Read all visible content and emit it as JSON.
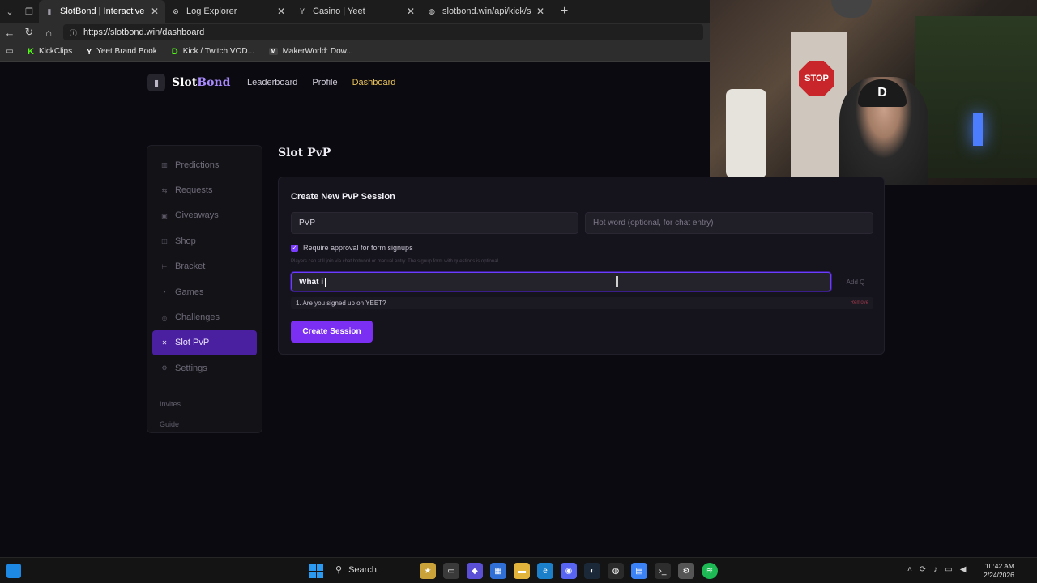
{
  "browser": {
    "tabs": [
      {
        "label": "SlotBond | Interactive Slot Streams",
        "icon": "slotbond-favicon",
        "active": true
      },
      {
        "label": "Log Explorer",
        "icon": "log-explorer-favicon",
        "active": false
      },
      {
        "label": "Casino | Yeet",
        "icon": "yeet-favicon",
        "active": false
      },
      {
        "label": "slotbond.win/api/kick/subscriptions",
        "icon": "globe-icon",
        "active": false
      }
    ],
    "url": "https://slotbond.win/dashboard",
    "bookmarks": [
      {
        "label": "KickClips",
        "icon": "K"
      },
      {
        "label": "Yeet Brand Book",
        "icon": "Y"
      },
      {
        "label": "Kick / Twitch VOD...",
        "icon": "D"
      },
      {
        "label": "MakerWorld: Dow...",
        "icon": "M"
      }
    ]
  },
  "webcam": {
    "sign_text": "STOP",
    "cap_letter": "D"
  },
  "site": {
    "logo_main": "Slot",
    "logo_accent": "Bond",
    "nav": [
      {
        "label": "Leaderboard"
      },
      {
        "label": "Profile"
      },
      {
        "label": "Dashboard",
        "active": true
      }
    ]
  },
  "sidebar": {
    "items": [
      {
        "label": "Predictions",
        "icon": "chart-icon"
      },
      {
        "label": "Requests",
        "icon": "requests-icon"
      },
      {
        "label": "Giveaways",
        "icon": "gift-icon"
      },
      {
        "label": "Shop",
        "icon": "bag-icon"
      },
      {
        "label": "Bracket",
        "icon": "bracket-icon"
      },
      {
        "label": "Games",
        "icon": "dot-icon"
      },
      {
        "label": "Challenges",
        "icon": "target-icon"
      },
      {
        "label": "Slot PvP",
        "icon": "swords-icon",
        "active": true
      },
      {
        "label": "Settings",
        "icon": "gear-icon"
      }
    ],
    "sub_items": [
      {
        "label": "Invites"
      },
      {
        "label": "Guide"
      }
    ]
  },
  "main": {
    "page_title": "Slot PvP",
    "panel_title": "Create New PvP Session",
    "session_name_value": "PVP",
    "hot_word_placeholder": "Hot word (optional, for chat entry)",
    "require_approval_label": "Require approval for form signups",
    "hint_text": "Players can still join via chat hotword or manual entry. The signup form with questions is optional.",
    "question_input_value": "What i",
    "add_question_label": "Add Q",
    "questions": [
      {
        "label": "1. Are you signed up on YEET?",
        "remove_label": "Remove"
      }
    ],
    "create_button_label": "Create Session"
  },
  "taskbar": {
    "search_label": "Search",
    "time": "10:42 AM",
    "date": "2/24/2026"
  },
  "colors": {
    "accent_purple": "#7b2ff2",
    "nav_active": "#e7c25a",
    "logo_accent": "#a98bff",
    "remove_red": "#a23a4d"
  }
}
